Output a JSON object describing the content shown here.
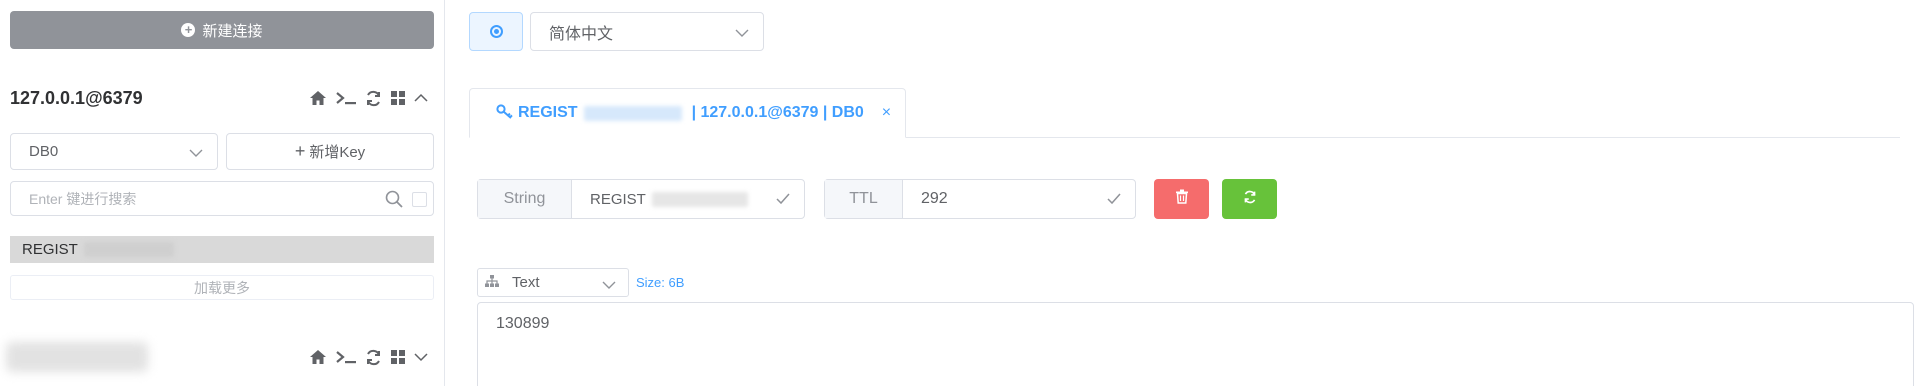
{
  "sidebar": {
    "new_connection_label": "新建连接",
    "connections": [
      {
        "name": "127.0.0.1@6379",
        "expanded": true
      },
      {
        "name": "",
        "expanded": false
      }
    ],
    "db_select": {
      "value": "DB0"
    },
    "add_key_label": "新增Key",
    "search": {
      "placeholder": "Enter 键进行搜索"
    },
    "keys": [
      {
        "label": "REGIST"
      }
    ],
    "load_more_label": "加载更多"
  },
  "header": {
    "language_select": {
      "value": "简体中文"
    }
  },
  "tab": {
    "key_label": "REGIST",
    "suffix_label": "| 127.0.0.1@6379 | DB0",
    "close_glyph": "×"
  },
  "key_detail": {
    "type_label": "String",
    "key_name": "REGIST",
    "ttl_label": "TTL",
    "ttl_value": "292",
    "format": "Text",
    "size_label": "Size: 6B",
    "value": "130899"
  },
  "colors": {
    "accent": "#409eff",
    "danger": "#f56c6c",
    "success": "#67c23a",
    "new_conn_bg": "#909399"
  },
  "icons": {
    "home": "home-icon",
    "terminal": "terminal-icon",
    "refresh": "refresh-icon",
    "grid": "grid-icon",
    "chevron": "chevron-icon",
    "search": "search-icon",
    "key": "key-icon",
    "trash": "trash-icon",
    "tree": "tree-icon"
  }
}
